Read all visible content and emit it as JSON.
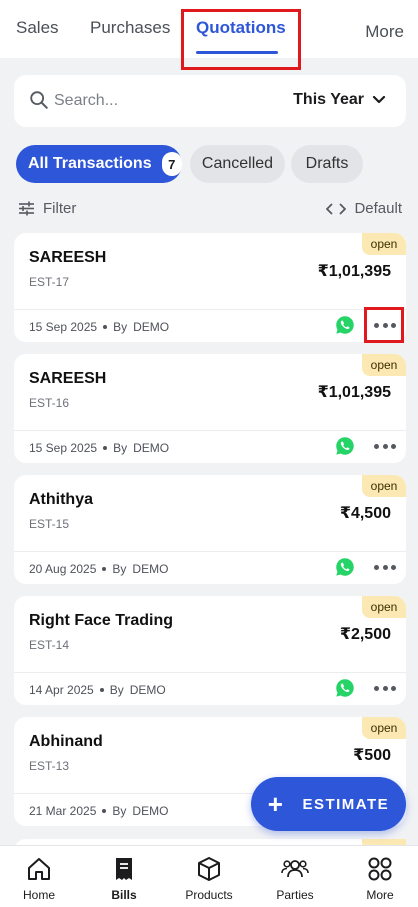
{
  "top_tabs": {
    "sales": "Sales",
    "purchases": "Purchases",
    "quotations": "Quotations",
    "more": "More"
  },
  "search": {
    "placeholder": "Search...",
    "period": "This Year"
  },
  "chips": {
    "all": "All Transactions",
    "all_count": "7",
    "cancelled": "Cancelled",
    "drafts": "Drafts"
  },
  "filter": {
    "filter_label": "Filter",
    "sort_label": "Default"
  },
  "transactions": [
    {
      "name": "SAREESH",
      "number": "EST-17",
      "amount": "₹1,01,395",
      "date": "15 Sep 2025",
      "by": "By",
      "user": "DEMO",
      "status": "open"
    },
    {
      "name": "SAREESH",
      "number": "EST-16",
      "amount": "₹1,01,395",
      "date": "15 Sep 2025",
      "by": "By",
      "user": "DEMO",
      "status": "open"
    },
    {
      "name": "Athithya",
      "number": "EST-15",
      "amount": "₹4,500",
      "date": "20 Aug 2025",
      "by": "By",
      "user": "DEMO",
      "status": "open"
    },
    {
      "name": "Right Face Trading",
      "number": "EST-14",
      "amount": "₹2,500",
      "date": "14 Apr 2025",
      "by": "By",
      "user": "DEMO",
      "status": "open"
    },
    {
      "name": "Abhinand",
      "number": "EST-13",
      "amount": "₹500",
      "date": "21 Mar 2025",
      "by": "By",
      "user": "DEMO",
      "status": "open"
    }
  ],
  "fab": {
    "label": "ESTIMATE"
  },
  "bottom_nav": {
    "home": "Home",
    "bills": "Bills",
    "products": "Products",
    "parties": "Parties",
    "more": "More"
  },
  "colors": {
    "accent": "#2e56d8",
    "badge_bg": "#fbe8b2",
    "whatsapp": "#25d366",
    "highlight": "#e0191f"
  }
}
